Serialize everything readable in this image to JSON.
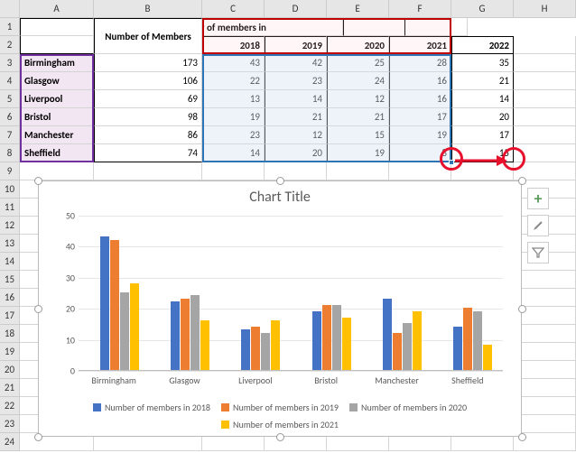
{
  "columns": [
    "A",
    "B",
    "C",
    "D",
    "E",
    "F",
    "G",
    "H"
  ],
  "rows": [
    "1",
    "2",
    "3",
    "4",
    "5",
    "6",
    "7",
    "8",
    "9",
    "10",
    "11",
    "12",
    "13",
    "14",
    "15",
    "16",
    "17",
    "18",
    "19",
    "20",
    "21",
    "22",
    "23",
    "24"
  ],
  "headers": {
    "members_label": "Number of Members",
    "members_in_label": "Number of members in",
    "years": [
      "2018",
      "2019",
      "2020",
      "2021",
      "2022"
    ]
  },
  "cities": [
    "Birmingham",
    "Glasgow",
    "Liverpool",
    "Bristol",
    "Manchester",
    "Sheffield"
  ],
  "table": {
    "members": [
      173,
      106,
      69,
      98,
      86,
      74
    ],
    "y2018": [
      43,
      22,
      13,
      19,
      23,
      14
    ],
    "y2019": [
      42,
      23,
      14,
      21,
      12,
      20
    ],
    "y2020": [
      25,
      24,
      12,
      21,
      15,
      19
    ],
    "y2021": [
      28,
      16,
      16,
      17,
      19,
      8
    ],
    "y2022": [
      35,
      21,
      14,
      20,
      17,
      15
    ]
  },
  "chart": {
    "title": "Chart Title",
    "yticks": [
      0,
      10,
      20,
      30,
      40,
      50
    ],
    "buttons": {
      "plus": "+",
      "brush": "🖌",
      "funnel": "▾"
    }
  },
  "legend": {
    "s0": "Number of members in 2018",
    "s1": "Number of members in 2019",
    "s2": "Number of members in 2020",
    "s3": "Number of members in 2021"
  },
  "chart_data": {
    "type": "bar",
    "title": "Chart Title",
    "xlabel": "",
    "ylabel": "",
    "ylim": [
      0,
      50
    ],
    "categories": [
      "Birmingham",
      "Glasgow",
      "Liverpool",
      "Bristol",
      "Manchester",
      "Sheffield"
    ],
    "series": [
      {
        "name": "Number of members in 2018",
        "values": [
          43,
          22,
          13,
          19,
          23,
          14
        ]
      },
      {
        "name": "Number of members in 2019",
        "values": [
          42,
          23,
          14,
          21,
          12,
          20
        ]
      },
      {
        "name": "Number of members in 2020",
        "values": [
          25,
          24,
          12,
          21,
          15,
          19
        ]
      },
      {
        "name": "Number of members in 2021",
        "values": [
          28,
          16,
          16,
          17,
          19,
          8
        ]
      }
    ]
  }
}
